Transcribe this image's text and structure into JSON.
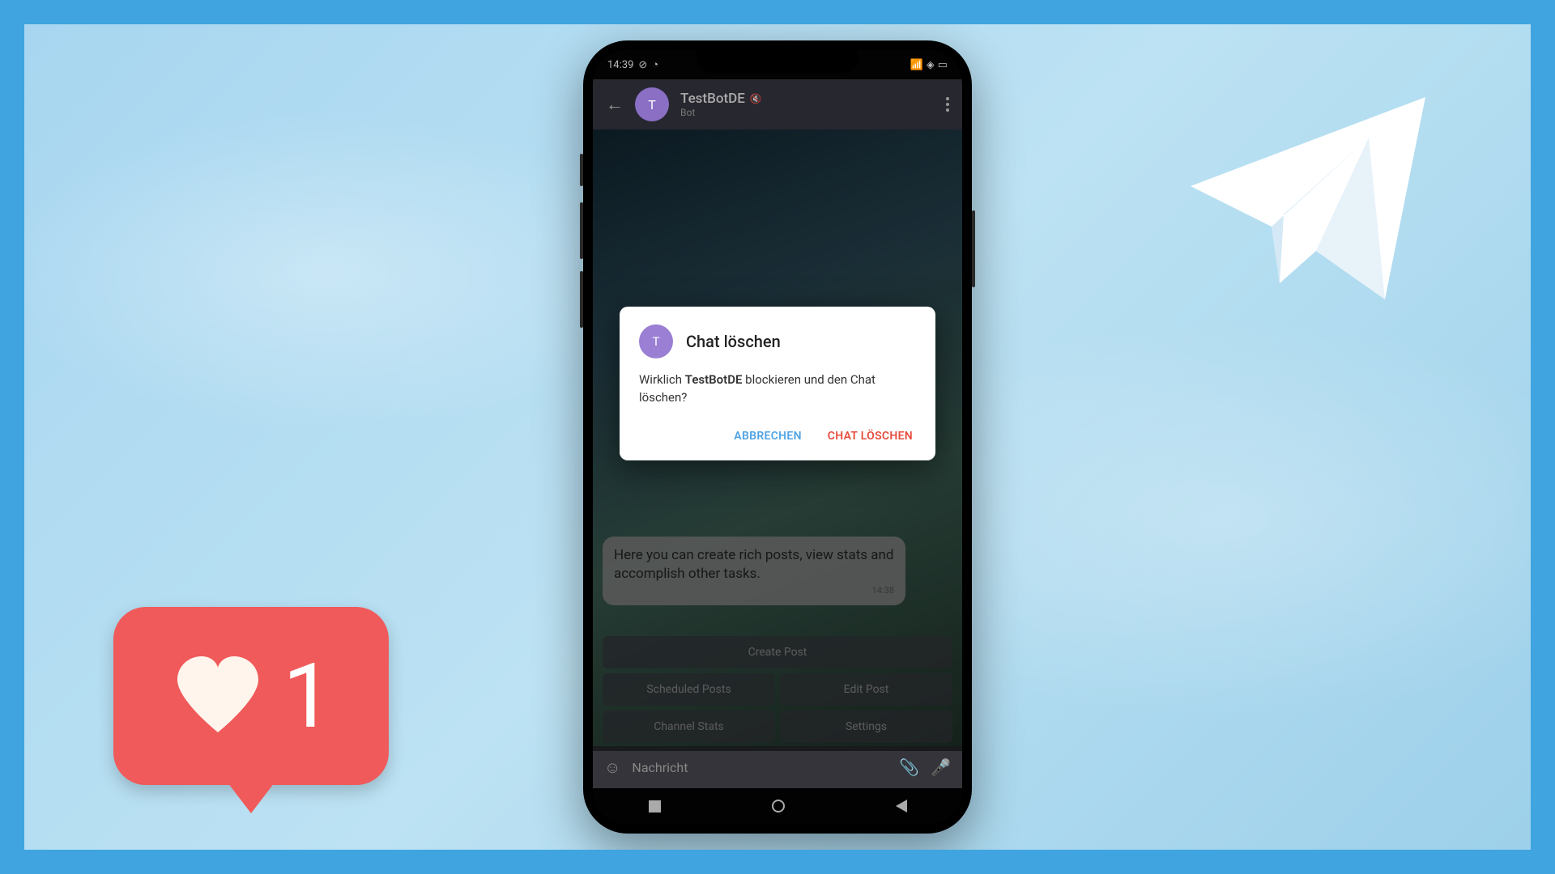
{
  "status": {
    "time": "14:39"
  },
  "header": {
    "title": "TestBotDE",
    "subtitle": "Bot",
    "avatar_letter": "T"
  },
  "message": {
    "text": "Here you can create rich posts, view stats and accomplish other tasks.",
    "time": "14:38"
  },
  "bot_buttons": {
    "create": "Create Post",
    "scheduled": "Scheduled Posts",
    "edit": "Edit Post",
    "stats": "Channel Stats",
    "settings": "Settings"
  },
  "dialog": {
    "avatar_letter": "T",
    "title": "Chat löschen",
    "body_prefix": "Wirklich ",
    "body_bold": "TestBotDE",
    "body_suffix": " blockieren und den Chat löschen?",
    "cancel": "ABBRECHEN",
    "confirm": "CHAT LÖSCHEN"
  },
  "input": {
    "placeholder": "Nachricht"
  },
  "like": {
    "count": "1"
  }
}
